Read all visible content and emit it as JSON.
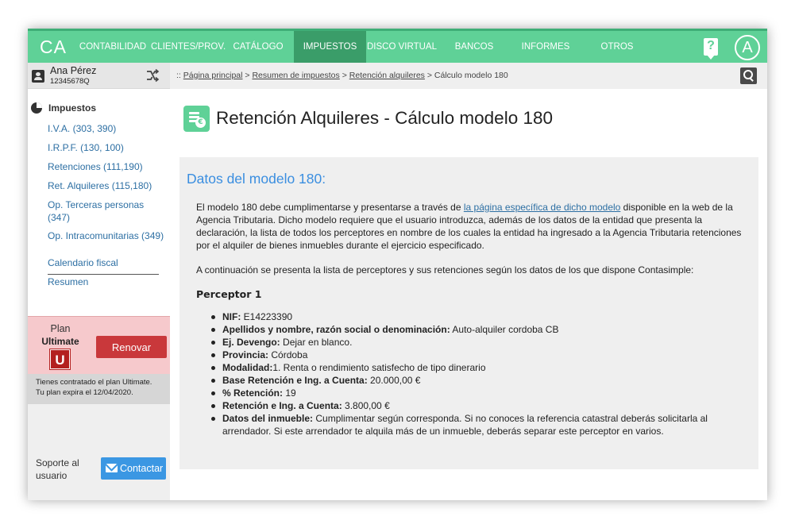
{
  "app": {
    "logo": "CA",
    "nav": [
      {
        "label": "CONTABILIDAD"
      },
      {
        "label": "CLIENTES/PROV."
      },
      {
        "label": "CATÁLOGO"
      },
      {
        "label": "IMPUESTOS"
      },
      {
        "label": "DISCO VIRTUAL"
      },
      {
        "label": "BANCOS"
      },
      {
        "label": "INFORMES"
      },
      {
        "label": "OTROS"
      }
    ],
    "active_nav": "IMPUESTOS",
    "help_glyph": "?",
    "avatar_letter": "A"
  },
  "user": {
    "name": "Ana Pérez",
    "id": "12345678Q",
    "shuffle_icon": "shuffle-icon"
  },
  "sidebar": {
    "section_title": "Impuestos",
    "links": [
      {
        "label": "I.V.A. (303, 390)"
      },
      {
        "label": "I.R.P.F. (130, 100)"
      },
      {
        "label": "Retenciones (111,190)"
      },
      {
        "label": "Ret. Alquileres (115,180)"
      },
      {
        "label": "Op. Terceras personas (347)"
      },
      {
        "label": "Op. Intracomunitarias (349)"
      },
      {
        "label": "Calendario fiscal"
      },
      {
        "label": "Resumen"
      }
    ],
    "plan": {
      "label": "Plan",
      "name": "Ultimate",
      "badge": "U",
      "renew_label": "Renovar",
      "info_line1": "Tienes contratado el plan Ultimate.",
      "info_line2": "Tu plan expira el 12/04/2020."
    },
    "support": {
      "label": "Soporte al usuario",
      "contact_label": "Contactar"
    }
  },
  "breadcrumb": {
    "prefix": "::",
    "items": [
      "Página principal",
      "Resumen de impuestos",
      "Retención alquileres"
    ],
    "current": "Cálculo modelo 180",
    "separator": ">"
  },
  "page": {
    "title": "Retención Alquileres - Cálculo modelo 180",
    "coin_glyph": "€",
    "panel_title": "Datos del modelo 180:",
    "para1_before": "El modelo 180 debe cumplimentarse y presentarse a través de ",
    "para1_link": "la página específica de dicho modelo",
    "para1_after": " disponible en la web de la Agencia Tributaria. Dicho modelo requiere que el usuario introduzca, además de los datos de la entidad que presenta la declaración, la lista de todos los perceptores en nombre de los cuales la entidad ha ingresado a la Agencia Tributaria retenciones por el alquiler de bienes inmuebles durante el ejercicio especificado.",
    "para2": "A continuación se presenta la lista de perceptores y sus retenciones según los datos de los que dispone Contasimple:",
    "perceptor_title": "Perceptor 1",
    "details": [
      {
        "label": "NIF:",
        "value": " E14223390"
      },
      {
        "label": "Apellidos y nombre, razón social o denominación:",
        "value": " Auto-alquiler cordoba CB"
      },
      {
        "label": "Ej. Devengo:",
        "value": " Dejar en blanco."
      },
      {
        "label": "Provincia:",
        "value": " Córdoba"
      },
      {
        "label": "Modalidad:",
        "value": "1. Renta o rendimiento satisfecho de tipo dinerario"
      },
      {
        "label": "Base Retención e Ing. a Cuenta:",
        "value": " 20.000,00 €"
      },
      {
        "label": "% Retención:",
        "value": " 19"
      },
      {
        "label": "Retención e Ing. a Cuenta:",
        "value": " 3.800,00 €"
      },
      {
        "label": "Datos del inmueble:",
        "value": " Cumplimentar según corresponda. Si no conoces la referencia catastral deberás solicitarla al arrendador. Si este arrendador te alquila más de un inmueble, deberás separar este perceptor en varios."
      }
    ]
  },
  "colors": {
    "brand": "#5fd197",
    "brand_dark": "#3a9d69",
    "link": "#2d6fa3",
    "panel_title": "#3a8ee0",
    "renew": "#c9383b",
    "contact": "#3b97e3"
  }
}
